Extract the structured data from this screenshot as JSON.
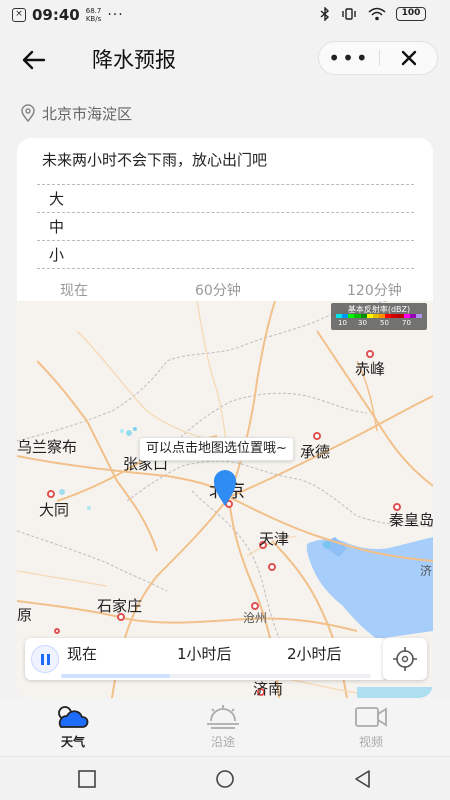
{
  "status_bar": {
    "time": "09:40",
    "net_speed_value": "68.7",
    "net_speed_unit": "KB/s",
    "notif_glyph": "×",
    "more": "···",
    "battery": "100"
  },
  "header": {
    "title": "降水预报",
    "more_label": "•••",
    "icons": {
      "back": "arrow-left-icon",
      "close": "close-icon"
    }
  },
  "location": {
    "text": "北京市海淀区",
    "icon": "location-pin-icon"
  },
  "forecast": {
    "summary": "未来两小时不会下雨，放心出门吧",
    "intensity_levels": [
      "大",
      "中",
      "小"
    ],
    "time_axis": [
      "现在",
      "60分钟",
      "120分钟"
    ]
  },
  "map": {
    "legend": {
      "title": "基本反射率(dBZ)",
      "ticks": [
        "10",
        "30",
        "50",
        "70"
      ],
      "colors": [
        "#00e4ec",
        "#0098f3",
        "#00fb00",
        "#00c200",
        "#008e00",
        "#fdf800",
        "#e6c000",
        "#fc8e00",
        "#fd0000",
        "#d30000",
        "#c00000",
        "#fd00f1",
        "#9500b4",
        "#ad90f0"
      ]
    },
    "tooltip": "可以点击地图选位置哦~",
    "cities": {
      "wulancabu": "乌兰察布",
      "zhangjiakou": "张家口",
      "chengde": "承德",
      "chifeng": "赤峰",
      "datong": "大同",
      "beijing": "北京",
      "tianjin": "天津",
      "qinhuangdao": "秦皇岛",
      "shijiazhuang": "石家庄",
      "cangzhou": "沧州",
      "jinan": "济南",
      "left_edge": "原",
      "right_edge": "济"
    },
    "player": {
      "labels": [
        "现在",
        "1小时后",
        "2小时后"
      ],
      "progress": 0.35
    }
  },
  "tabs": [
    {
      "label": "天气",
      "icon": "weather-cloud-icon",
      "active": true
    },
    {
      "label": "沿途",
      "icon": "route-sun-icon",
      "active": false
    },
    {
      "label": "视频",
      "icon": "video-camera-icon",
      "active": false
    }
  ],
  "accent_color": "#1e6dfa"
}
